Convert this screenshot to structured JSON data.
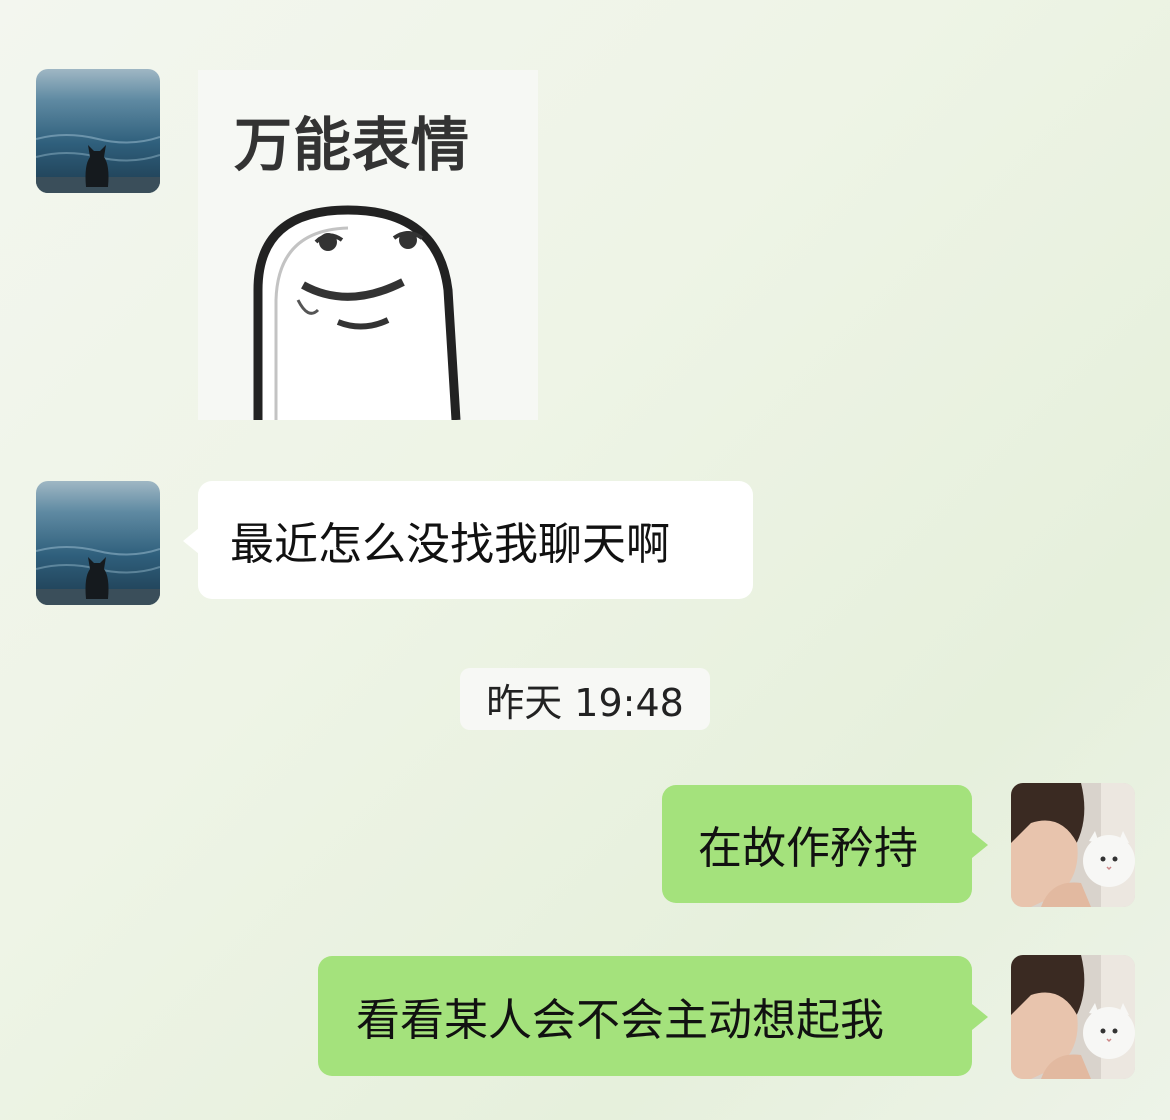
{
  "messages": [
    {
      "side": "incoming",
      "type": "sticker",
      "caption": "万能表情",
      "avatar_icon": "cat-by-sea-avatar-icon"
    },
    {
      "side": "incoming",
      "type": "text",
      "text": "最近怎么没找我聊天啊",
      "avatar_icon": "cat-by-sea-avatar-icon"
    },
    {
      "side": "outgoing",
      "type": "text",
      "text": "在故作矜持",
      "avatar_icon": "girl-with-white-cat-avatar-icon"
    },
    {
      "side": "outgoing",
      "type": "text",
      "text": "看看某人会不会主动想起我",
      "avatar_icon": "girl-with-white-cat-avatar-icon"
    }
  ],
  "timestamp": "昨天 19:48",
  "colors": {
    "incoming_bubble": "#ffffff",
    "outgoing_bubble": "#a4e27c",
    "background": "#eef4e6"
  }
}
